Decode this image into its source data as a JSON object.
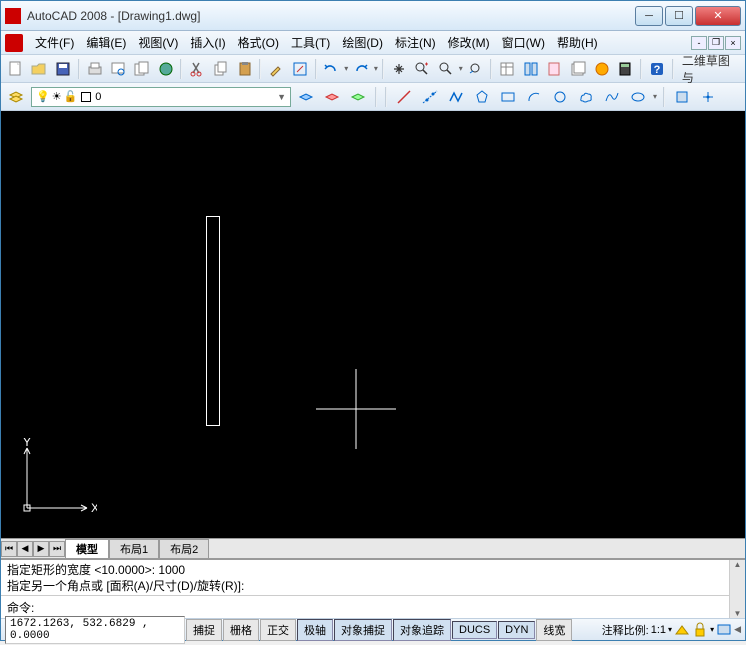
{
  "titlebar": {
    "app": "AutoCAD 2008",
    "doc": "[Drawing1.dwg]"
  },
  "menu": {
    "items": [
      "文件(F)",
      "编辑(E)",
      "视图(V)",
      "插入(I)",
      "格式(O)",
      "工具(T)",
      "绘图(D)",
      "标注(N)",
      "修改(M)",
      "窗口(W)",
      "帮助(H)"
    ]
  },
  "toolbar1_tail": "二维草图与",
  "layer": {
    "current": "0"
  },
  "tabs": {
    "items": [
      "模型",
      "布局1",
      "布局2"
    ],
    "activeIndex": 0
  },
  "command": {
    "line1": "指定矩形的宽度 <10.0000>: 1000",
    "line2": "指定另一个角点或 [面积(A)/尺寸(D)/旋转(R)]:",
    "prompt": "命令:",
    "input": ""
  },
  "status": {
    "coords": "1672.1263, 532.6829 , 0.0000",
    "buttons": [
      "捕捉",
      "栅格",
      "正交",
      "极轴",
      "对象捕捉",
      "对象追踪",
      "DUCS",
      "DYN",
      "线宽"
    ],
    "active": [
      3,
      4,
      5,
      6,
      7
    ],
    "annolabel": "注释比例:",
    "annoscale": "1:1"
  },
  "ucs": {
    "x": "X",
    "y": "Y"
  }
}
